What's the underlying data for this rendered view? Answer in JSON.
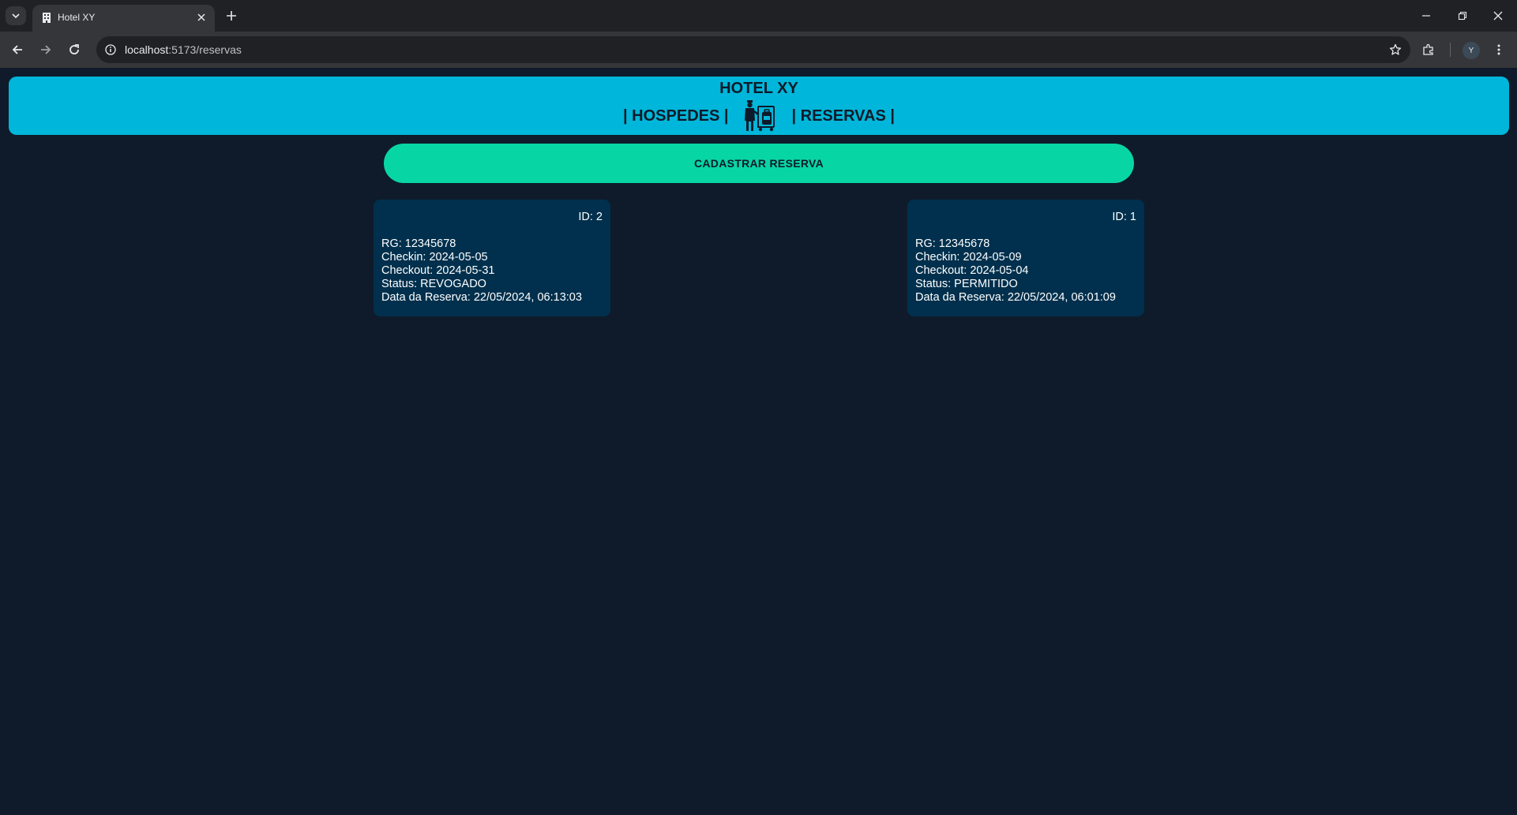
{
  "browser": {
    "tab_title": "Hotel XY",
    "url_host": "localhost",
    "url_path": ":5173/reservas",
    "profile_initial": "Y",
    "icons": [
      "tab-search-icon",
      "building-favicon",
      "close-icon",
      "plus-icon",
      "minimize-icon",
      "restore-icon",
      "close-window-icon",
      "back-arrow-icon",
      "forward-arrow-icon",
      "reload-icon",
      "site-info-icon",
      "star-icon",
      "extensions-icon",
      "menu-dots-icon"
    ]
  },
  "header": {
    "brand": "HOTEL XY",
    "nav_hospedes": "| HOSPEDES |",
    "nav_reservas": "| RESERVAS |",
    "icon": "bellhop-luggage-icon"
  },
  "actions": {
    "register_button": "CADASTRAR RESERVA"
  },
  "reservations": [
    {
      "id": "ID: 2",
      "rg": "RG: 12345678",
      "checkin": "Checkin: 2024-05-05",
      "checkout": "Checkout: 2024-05-31",
      "status": "Status: REVOGADO",
      "date": "Data da Reserva: 22/05/2024, 06:13:03"
    },
    {
      "id": "ID: 1",
      "rg": "RG: 12345678",
      "checkin": "Checkin: 2024-05-09",
      "checkout": "Checkout: 2024-05-04",
      "status": "Status: PERMITIDO",
      "date": "Data da Reserva: 22/05/2024, 06:01:09"
    }
  ],
  "colors": {
    "page_bg": "#0f1b2a",
    "header_bg": "#00b6da",
    "button_bg": "#07d6a4",
    "card_bg": "#00304d"
  }
}
